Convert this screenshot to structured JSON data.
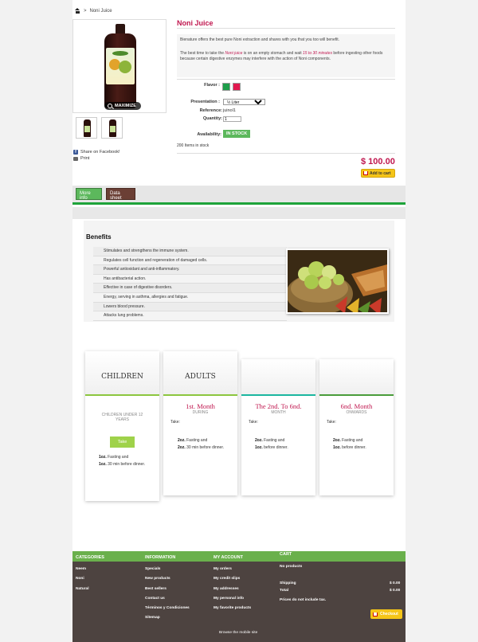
{
  "breadcrumb": {
    "separator": ">",
    "current": "Noni Juice"
  },
  "product": {
    "title": "Noni Juice",
    "maximize_label": "MAXIMIZE",
    "description_1": "Bienature offers the best pure Noni extraction and shares with you that you too will benefit.",
    "description_2_pre": "The best time to take the ",
    "description_2_em1": "Noni juice",
    "description_2_mid": " is on an empty stomach and wait ",
    "description_2_em2": "15 to 30 minutes",
    "description_2_post": " before ingesting other foods because certain digestive enzymes may interfere with the action of Noni components.",
    "flavor_label": "Flavor :",
    "flavor_colors": [
      "#1e9e4a",
      "#e2184f"
    ],
    "presentation_label": "Presentation :",
    "presentation_value": "½ Liter",
    "reference_label": "Reference:",
    "reference_value": "juinol1",
    "quantity_label": "Quantity:",
    "quantity_value": "1",
    "availability_label": "Availability:",
    "availability_value": "IN STOCK",
    "stock_count": "200 Items in stock",
    "price": "$ 100.00",
    "add_to_cart": "Add to cart",
    "share_facebook": "Share on Facebook!",
    "print": "Print"
  },
  "tabs": {
    "more_info": "More info",
    "data_sheet": "Data sheet"
  },
  "benefits": {
    "title": "Benefits",
    "items": [
      "Stimulates and strengthens the immune system.",
      "Regulates cell function and regeneration of damaged cells.",
      "Powerful antioxidant and anti-inflammatory.",
      "Has antibacterial action.",
      "Effective in case of digestive disorders.",
      "Energy, serving in asthma, allergies and fatigue.",
      "Lowers blood pressure.",
      "Attacks lung problems."
    ]
  },
  "plans": [
    {
      "header": "CHILDREN",
      "sub": "",
      "sub2": "CHILDREN UNDER 12 YEARS",
      "take": "Take",
      "line1_qty": "1oz.",
      "line1_text": "Fasting and",
      "line2_qty": "1oz.",
      "line2_text": "30 min before dinner.",
      "color": "#8cc63f"
    },
    {
      "header": "ADULTS",
      "sub": "1st. Month",
      "sub2": "DURING",
      "take": "Take:",
      "line1_qty": "2oz.",
      "line1_text": "Fasting and",
      "line2_qty": "2oz.",
      "line2_text": "30 min before dinner.",
      "color": "#8cc63f"
    },
    {
      "header": "",
      "sub": "The 2nd. To 6nd.",
      "sub2": "MONTH",
      "take": "Take:",
      "line1_qty": "2oz.",
      "line1_text": "Fasting and",
      "line2_qty": "1oz.",
      "line2_text": "before dinner.",
      "color": "#1bb6a0"
    },
    {
      "header": "",
      "sub": "6nd. Month",
      "sub2": "ONWARDS",
      "take": "Take:",
      "line1_qty": "2oz.",
      "line1_text": "Fasting and",
      "line2_qty": "1oz.",
      "line2_text": "before dinner.",
      "color": "#4a9c3a"
    }
  ],
  "footer": {
    "categories": {
      "title": "CATEGORIES",
      "items": [
        "Neem",
        "Noni",
        "Natural"
      ]
    },
    "information": {
      "title": "INFORMATION",
      "items": [
        "Specials",
        "New products",
        "Best sellers",
        "Contact us",
        "Términos y Condiciones",
        "Sitemap"
      ]
    },
    "account": {
      "title": "MY ACCOUNT",
      "items": [
        "My orders",
        "My credit slips",
        "My addresses",
        "My personal info",
        "My favorite products"
      ]
    },
    "cart": {
      "title": "CART",
      "no_products": "No products",
      "shipping_label": "Shipping",
      "shipping_value": "$ 0.00",
      "total_label": "Total",
      "total_value": "$ 0.00",
      "tax_note": "Prices do not include tax.",
      "checkout": "Checkout"
    },
    "mobile_link": "Browse the mobile site"
  }
}
